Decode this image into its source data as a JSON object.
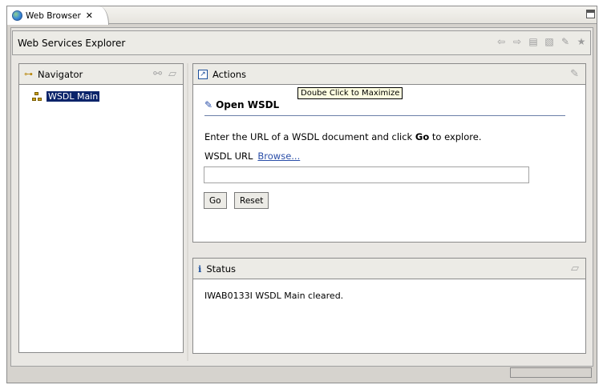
{
  "tab": {
    "title": "Web Browser",
    "close_glyph": "✕"
  },
  "explorer": {
    "title": "Web Services Explorer"
  },
  "toolbar": {
    "icons": [
      "back-icon",
      "forward-icon",
      "favorites-icon",
      "add-favorite-icon",
      "clear-icon",
      "star-icon"
    ]
  },
  "navigator": {
    "title": "Navigator",
    "item": "WSDL Main"
  },
  "actions": {
    "title": "Actions",
    "tooltip": "Doube Click to Maximize",
    "section_title": "Open WSDL",
    "instruction_prefix": "Enter the URL of a WSDL document and click ",
    "instruction_bold": "Go",
    "instruction_suffix": " to explore.",
    "url_label": "WSDL URL",
    "browse_link": "Browse...",
    "url_value": "",
    "go_label": "Go",
    "reset_label": "Reset"
  },
  "status": {
    "title": "Status",
    "message": "IWAB0133I WSDL Main cleared."
  },
  "colors": {
    "selection": "#0a246a",
    "link": "#2a4ea8",
    "tooltip_bg": "#ffffe1"
  }
}
